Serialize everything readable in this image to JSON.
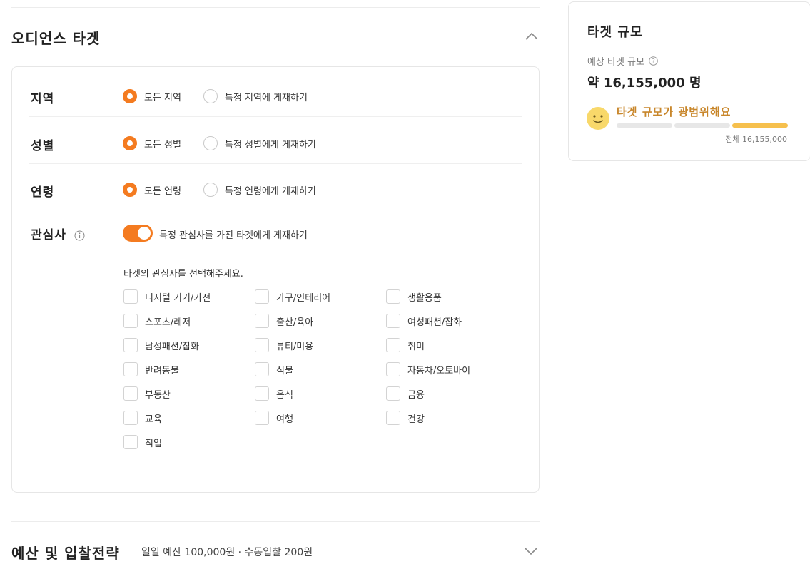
{
  "audience": {
    "title": "오디언스 타겟",
    "region": {
      "label": "지역",
      "opt_all": "모든 지역",
      "opt_specific": "특정 지역에 게재하기"
    },
    "gender": {
      "label": "성별",
      "opt_all": "모든 성별",
      "opt_specific": "특정 성별에게 게재하기"
    },
    "age": {
      "label": "연령",
      "opt_all": "모든 연령",
      "opt_specific": "특정 연령에게 게재하기"
    },
    "interest": {
      "label": "관심사",
      "toggle_label": "특정 관심사를 가진 타겟에게 게재하기",
      "toggle_on": true,
      "prompt": "타겟의 관심사를 선택해주세요.",
      "options": [
        "디지털 기기/가전",
        "가구/인테리어",
        "생활용품",
        "스포츠/레저",
        "출산/육아",
        "여성패션/잡화",
        "남성패션/잡화",
        "뷰티/미용",
        "취미",
        "반려동물",
        "식물",
        "자동차/오토바이",
        "부동산",
        "음식",
        "금융",
        "교육",
        "여행",
        "건강",
        "직업"
      ]
    }
  },
  "budget": {
    "title": "예산 및 입찰전략",
    "summary": "일일 예산 100,000원 · 수동입찰 200원"
  },
  "target_size": {
    "title": "타겟 규모",
    "subtitle": "예상 타겟 규모",
    "value": "약 16,155,000 명",
    "status": "타겟 규모가 광범위해요",
    "level_filled": 3,
    "level_total": 3,
    "total": "전체 16,155,000"
  },
  "colors": {
    "accent": "#f47b20",
    "status_text": "#c8862a",
    "gauge": "#f6c04d"
  },
  "icons": {
    "collapse": "chevron-up-icon",
    "expand": "chevron-down-icon",
    "info": "info-icon",
    "help": "question-circle-icon",
    "status": "smiley-icon"
  }
}
